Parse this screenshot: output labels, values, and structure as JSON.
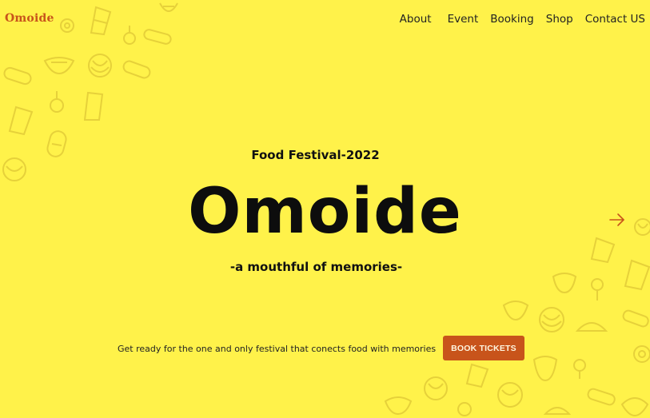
{
  "header": {
    "logo": "Omoide",
    "nav": [
      "About",
      "Event",
      "Booking",
      "Shop",
      "Contact US"
    ]
  },
  "hero": {
    "kicker": "Food Festival-2022",
    "title": "Omoide",
    "tagline": "-a mouthful of memories-",
    "next_icon": "arrow-right-icon"
  },
  "cta": {
    "text": "Get ready for the one and only festival that conects food with memories",
    "button_label": "BOOK TICKETS"
  },
  "colors": {
    "background": "#FFF24A",
    "accent": "#C8541B",
    "doodle": "#E8D33A"
  },
  "decor": {
    "icons": [
      "food-doodle-icon"
    ]
  }
}
